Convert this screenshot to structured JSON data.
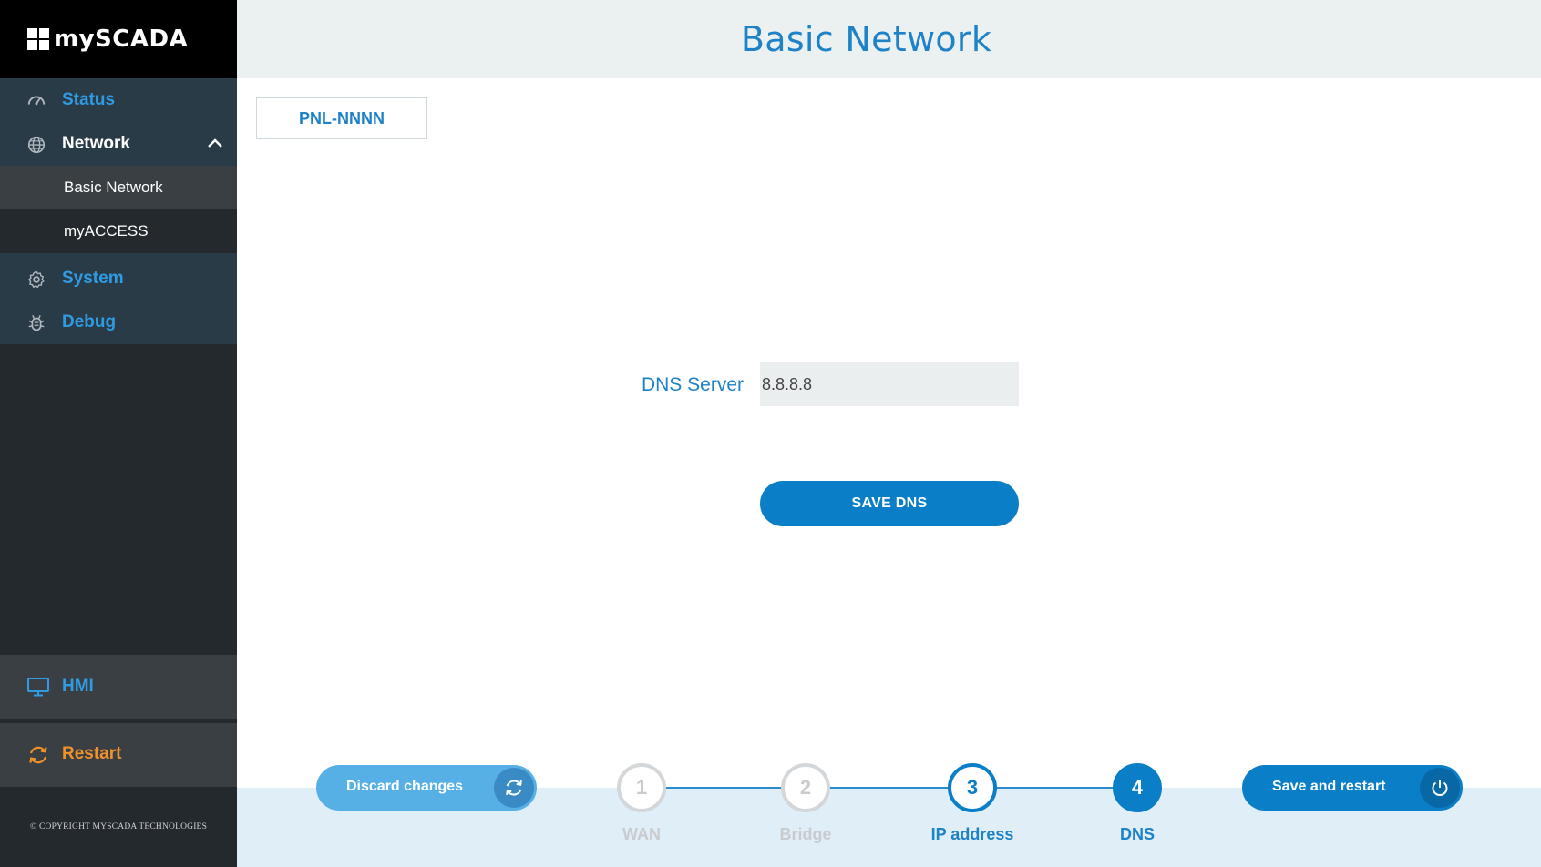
{
  "brand": {
    "name": "mySCADA"
  },
  "sidebar": {
    "items": [
      {
        "label": "Status",
        "icon": "speedometer-icon"
      },
      {
        "label": "Network",
        "icon": "globe-icon",
        "expanded": true
      },
      {
        "label": "System",
        "icon": "gear-icon"
      },
      {
        "label": "Debug",
        "icon": "bug-icon"
      }
    ],
    "network_sub": [
      {
        "label": "Basic Network",
        "active": true
      },
      {
        "label": "myACCESS",
        "active": false
      }
    ],
    "hmi": {
      "label": "HMI",
      "icon": "monitor-icon"
    },
    "restart": {
      "label": "Restart",
      "icon": "refresh-icon"
    },
    "copyright": "© COPYRIGHT MYSCADA TECHNOLOGIES"
  },
  "header": {
    "title": "Basic Network"
  },
  "device": {
    "name": "PNL-NNNN"
  },
  "form": {
    "dns_label": "DNS Server",
    "dns_value": "8.8.8.8",
    "save_label": "SAVE DNS"
  },
  "footer": {
    "discard_label": "Discard changes",
    "save_restart_label": "Save and restart",
    "steps": [
      {
        "number": "1",
        "label": "WAN",
        "state": "done"
      },
      {
        "number": "2",
        "label": "Bridge",
        "state": "done"
      },
      {
        "number": "3",
        "label": "IP address",
        "state": "current"
      },
      {
        "number": "4",
        "label": "DNS",
        "state": "active"
      }
    ]
  },
  "colors": {
    "accent": "#0a7fc7",
    "link_blue": "#2e9be2",
    "orange": "#f0912a",
    "sidebar_bg": "#24292e",
    "nav_bg": "#2a3b48"
  }
}
